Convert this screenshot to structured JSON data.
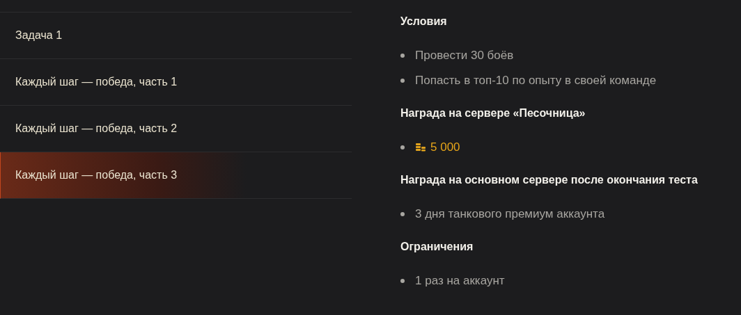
{
  "tasks": [
    {
      "label": "Задача 1",
      "selected": false
    },
    {
      "label": "Каждый шаг — победа, часть 1",
      "selected": false
    },
    {
      "label": "Каждый шаг — победа, часть 2",
      "selected": false
    },
    {
      "label": "Каждый шаг — победа, часть 3",
      "selected": true
    }
  ],
  "sections": [
    {
      "heading": "Условия",
      "items": [
        {
          "kind": "text",
          "text": "Провести 30 боёв"
        },
        {
          "kind": "text",
          "text": "Попасть в топ-10 по опыту в своей команде"
        }
      ]
    },
    {
      "heading": "Награда на сервере «Песочница»",
      "items": [
        {
          "kind": "currency",
          "text": "5 000"
        }
      ]
    },
    {
      "heading": "Награда на основном сервере после окончания теста",
      "items": [
        {
          "kind": "text",
          "text": "3 дня танкового премиум аккаунта"
        }
      ]
    },
    {
      "heading": "Ограничения",
      "items": [
        {
          "kind": "text",
          "text": "1 раз на аккаунт"
        }
      ]
    }
  ]
}
